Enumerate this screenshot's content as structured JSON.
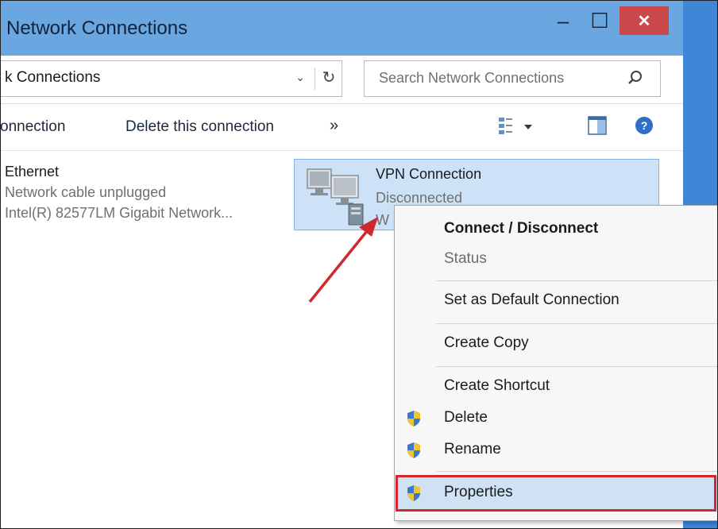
{
  "window": {
    "title": "Network Connections",
    "minimize_glyph": "‒",
    "maximize_glyph": "☐",
    "close_glyph": "✕"
  },
  "address": {
    "path_text": "k Connections",
    "chevron": "⌄",
    "refresh_glyph": "↻"
  },
  "search": {
    "placeholder": "Search Network Connections",
    "icon": "search-icon"
  },
  "toolbar": {
    "item1": "onnection",
    "item2": "Delete this connection",
    "more": "»"
  },
  "items": {
    "ethernet": {
      "name": "Ethernet",
      "status": "Network cable unplugged",
      "device": "Intel(R) 82577LM Gigabit Network..."
    },
    "vpn": {
      "name": "VPN Connection",
      "status": "Disconnected",
      "tag": "W"
    }
  },
  "context_menu": {
    "items": [
      {
        "label": "Connect / Disconnect"
      },
      {
        "label": "Status"
      },
      {
        "label": "Set as Default Connection"
      },
      {
        "label": "Create Copy"
      },
      {
        "label": "Create Shortcut"
      },
      {
        "label": "Delete"
      },
      {
        "label": "Rename"
      },
      {
        "label": "Properties"
      }
    ]
  },
  "colors": {
    "titlebar": "#6aa6e0",
    "close_button": "#c9484a",
    "selection": "#cde2f6",
    "highlight_border": "#d0282f",
    "arrow": "#d0282f"
  }
}
